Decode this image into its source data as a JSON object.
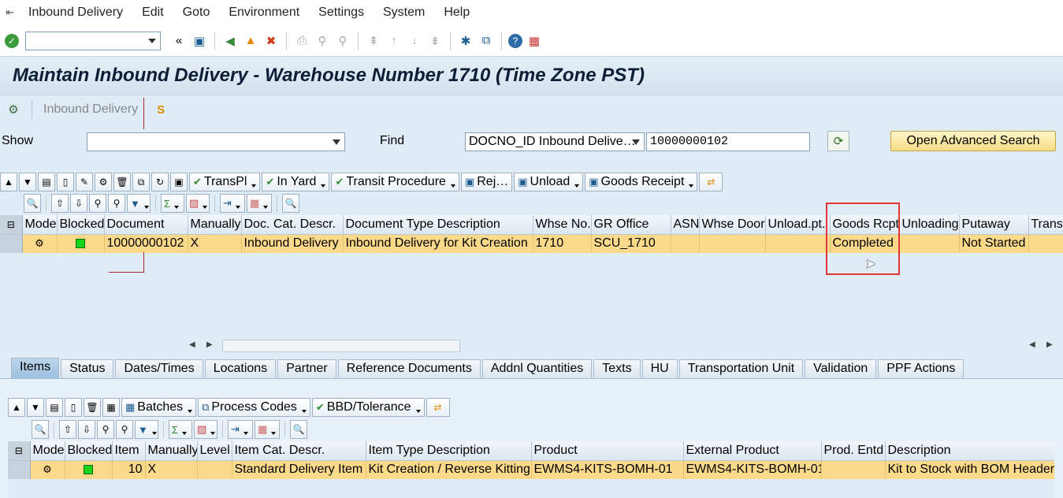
{
  "menubar": {
    "items": [
      "Inbound Delivery",
      "Edit",
      "Goto",
      "Environment",
      "Settings",
      "System",
      "Help"
    ]
  },
  "title": "Maintain Inbound Delivery - Warehouse Number 1710 (Time Zone PST)",
  "app_toolbar": {
    "label": "Inbound Delivery"
  },
  "find": {
    "show_label": "Show",
    "show_value": "",
    "find_label": "Find",
    "find_type": "DOCNO_ID Inbound Delive…",
    "find_value": "10000000102",
    "advanced_search": "Open Advanced Search"
  },
  "header_toolbar": {
    "transpl": "TransPl",
    "in_yard": "In Yard",
    "transit_procedure": "Transit Procedure",
    "reject": "Rej…",
    "unload": "Unload",
    "goods_receipt": "Goods Receipt"
  },
  "header_grid": {
    "columns": [
      "Mode",
      "Blocked",
      "Document",
      "Manually",
      "Doc. Cat. Descr.",
      "Document Type Description",
      "Whse No.",
      "GR Office",
      "ASN",
      "Whse Door",
      "Unload.pt.",
      "Goods Rcpt",
      "Unloading",
      "Putaway",
      "Transi"
    ],
    "rows": [
      {
        "mode": "",
        "blocked": "green",
        "document": "10000000102",
        "manually": "X",
        "doc_cat": "Inbound Delivery",
        "doc_type": "Inbound Delivery for Kit Creation",
        "whse_no": "1710",
        "gr_office": "SCU_1710",
        "asn": "",
        "whse_door": "",
        "unload_pt": "",
        "goods_rcpt": "Completed",
        "unloading": "",
        "putaway": "Not Started",
        "transit": ""
      }
    ]
  },
  "tabs": [
    "Items",
    "Status",
    "Dates/Times",
    "Locations",
    "Partner",
    "Reference Documents",
    "Addnl Quantities",
    "Texts",
    "HU",
    "Transportation Unit",
    "Validation",
    "PPF Actions"
  ],
  "items_toolbar": {
    "batches": "Batches",
    "process_codes": "Process Codes",
    "bbd_tolerance": "BBD/Tolerance"
  },
  "items_grid": {
    "columns": [
      "Mode",
      "Blocked",
      "Item",
      "Manually",
      "Level",
      "Item Cat. Descr.",
      "Item Type Description",
      "Product",
      "External Product",
      "Prod. Entd",
      "Description"
    ],
    "rows": [
      {
        "mode": "",
        "blocked": "green",
        "item": "10",
        "manually": "X",
        "level": "",
        "item_cat": "Standard Delivery Item",
        "item_type": "Kit Creation / Reverse Kitting",
        "product": "EWMS4-KITS-BOMH-01",
        "external_product": "EWMS4-KITS-BOMH-01",
        "prod_entd": "",
        "description": "Kit to Stock with BOM Header i"
      }
    ]
  }
}
